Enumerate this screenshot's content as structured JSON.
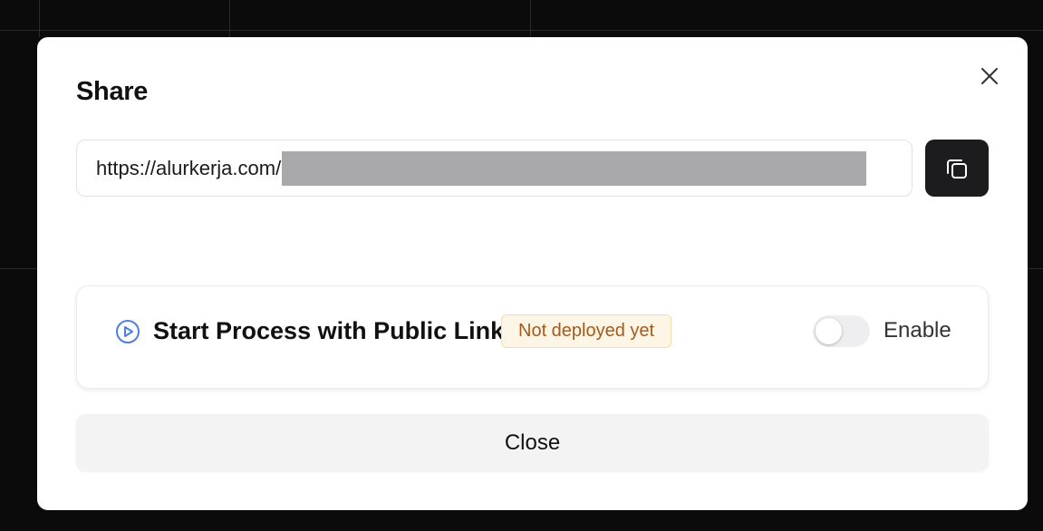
{
  "dialog": {
    "title": "Share",
    "url": {
      "prefix": "https://alurkerja.com/"
    },
    "process": {
      "title": "Start Process with Public Link",
      "status_badge": "Not deployed yet",
      "toggle_label": "Enable",
      "toggle_enabled": false
    },
    "close_label": "Close"
  },
  "icons": {
    "close": "close-icon",
    "copy": "copy-icon",
    "play": "play-circle-icon"
  },
  "colors": {
    "accent_blue": "#4f7fe0",
    "badge_text": "#a45a1b",
    "badge_bg": "#fdf6e6",
    "copy_button_bg": "#1c1c1e"
  }
}
